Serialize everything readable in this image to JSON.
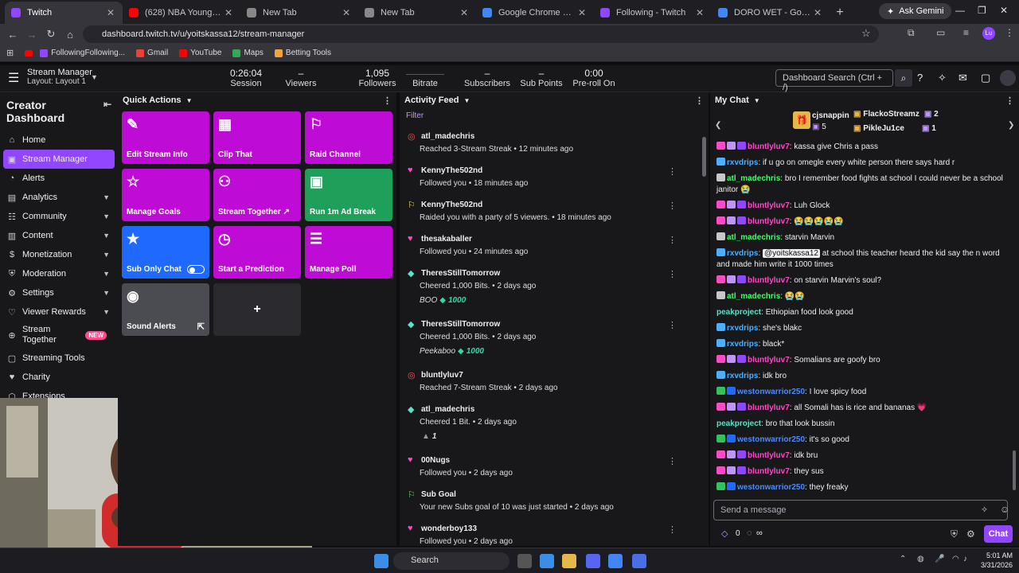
{
  "browser": {
    "tabs": [
      {
        "title": "Twitch",
        "color": "#9147ff"
      },
      {
        "title": "(628) NBA Youngboy - Boss",
        "color": "#ff0000"
      },
      {
        "title": "New Tab",
        "color": "#888888"
      },
      {
        "title": "New Tab",
        "color": "#888888"
      },
      {
        "title": "Google Chrome Help",
        "color": "#4285f4"
      },
      {
        "title": "Following - Twitch",
        "color": "#9147ff"
      },
      {
        "title": "DORO WET - Google Search",
        "color": "#4285f4"
      }
    ],
    "ask_gemini": "Ask Gemini",
    "url": "dashboard.twitch.tv/u/yoitskassa12/stream-manager",
    "profile_initials": "Lu",
    "bookmarks": [
      "FollowingFollowing...",
      "Gmail",
      "YouTube",
      "Maps",
      "Betting Tools"
    ]
  },
  "header": {
    "title": "Stream Manager",
    "subtitle": "Layout: Layout 1",
    "stats": [
      {
        "value": "0:26:04",
        "label": "Session"
      },
      {
        "value": "–",
        "label": "Viewers"
      },
      {
        "value": "1,095",
        "label": "Followers"
      },
      {
        "value": "",
        "label": "Bitrate"
      },
      {
        "value": "–",
        "label": "Subscribers"
      },
      {
        "value": "–",
        "label": "Sub Points"
      },
      {
        "value": "0:00",
        "label": "Pre-roll On"
      }
    ],
    "search_placeholder": "Dashboard Search (Ctrl + /)"
  },
  "sidebar": {
    "title": "Creator Dashboard",
    "items": [
      {
        "label": "Home"
      },
      {
        "label": "Stream Manager"
      },
      {
        "label": "Alerts"
      },
      {
        "label": "Analytics"
      },
      {
        "label": "Community"
      },
      {
        "label": "Content"
      },
      {
        "label": "Monetization"
      },
      {
        "label": "Moderation"
      },
      {
        "label": "Settings"
      },
      {
        "label": "Viewer Rewards"
      },
      {
        "label": "Stream Together",
        "badge": "NEW"
      },
      {
        "label": "Streaming Tools"
      },
      {
        "label": "Charity"
      },
      {
        "label": "Extensions"
      }
    ]
  },
  "quick_actions": {
    "title": "Quick Actions",
    "tiles": [
      {
        "label": "Edit Stream Info",
        "color": "#bf0bd6",
        "icon": "pencil-icon"
      },
      {
        "label": "Clip That",
        "color": "#bf0bd6",
        "icon": "clapper-icon"
      },
      {
        "label": "Raid Channel",
        "color": "#bf0bd6",
        "icon": "raid-icon"
      },
      {
        "label": "Manage Goals",
        "color": "#bf0bd6",
        "icon": "star-icon"
      },
      {
        "label": "Stream Together ↗",
        "color": "#bf0bd6",
        "icon": "add-user-icon"
      },
      {
        "label": "Run 1m Ad Break",
        "color": "#1fa05a",
        "icon": "ad-icon"
      },
      {
        "label": "Sub Only Chat",
        "color": "#1f69ff",
        "icon": "star-icon"
      },
      {
        "label": "Start a Prediction",
        "color": "#bf0bd6",
        "icon": "prediction-icon"
      },
      {
        "label": "Manage Poll",
        "color": "#bf0bd6",
        "icon": "poll-icon"
      },
      {
        "label": "Sound Alerts",
        "color": "#4b4b52",
        "icon": "sound-icon"
      },
      {
        "label": "+",
        "color": "#2a2a2f",
        "icon": "plus-icon"
      }
    ]
  },
  "activity": {
    "title": "Activity Feed",
    "filter": "Filter",
    "events": [
      {
        "name": "atl_madechris",
        "desc": "Reached 3-Stream Streak • 12 minutes ago",
        "icon": "streak-icon",
        "color": "#ff4a4a"
      },
      {
        "name": "KennyThe502nd",
        "desc": "Followed you • 18 minutes ago",
        "icon": "heart-icon",
        "color": "#ff4ac8"
      },
      {
        "name": "KennyThe502nd",
        "desc": "Raided you with a party of 5 viewers. • 18 minutes ago",
        "icon": "raid-icon",
        "color": "#f4e04d"
      },
      {
        "name": "thesakaballer",
        "desc": "Followed you • 24 minutes ago",
        "icon": "heart-icon",
        "color": "#ff4ac8"
      },
      {
        "name": "TheresStillTomorrow",
        "desc": "Cheered 1,000 Bits. • 2 days ago",
        "icon": "bits-icon",
        "color": "#5ce1c6",
        "extra": "BOO",
        "bits": "1000"
      },
      {
        "name": "TheresStillTomorrow",
        "desc": "Cheered 1,000 Bits. • 2 days ago",
        "icon": "bits-icon",
        "color": "#5ce1c6",
        "extra": "Peekaboo",
        "bits": "1000"
      },
      {
        "name": "bluntlyluv7",
        "desc": "Reached 7-Stream Streak • 2 days ago",
        "icon": "streak-icon",
        "color": "#ff4a4a"
      },
      {
        "name": "atl_madechris",
        "desc": "Cheered 1 Bit. • 2 days ago",
        "icon": "bits-icon",
        "color": "#5ce1c6",
        "bits": "1"
      },
      {
        "name": "00Nugs",
        "desc": "Followed you • 2 days ago",
        "icon": "heart-icon",
        "color": "#ff4ac8"
      },
      {
        "name": "Sub Goal",
        "desc": "Your new Subs goal of 10 was just started • 2 days ago",
        "icon": "goal-icon",
        "color": "#5ce15c"
      },
      {
        "name": "wonderboy133",
        "desc": "Followed you • 2 days ago",
        "icon": "heart-icon",
        "color": "#ff4ac8"
      }
    ]
  },
  "chat": {
    "title": "My Chat",
    "leaderboard": [
      {
        "name": "cjsnappin",
        "count": "5"
      },
      {
        "name": "FlackoStreamz",
        "count": "2"
      },
      {
        "name": "PikleJu1ce",
        "count": "1"
      }
    ],
    "messages": [
      {
        "user": "bluntlyluv7",
        "color": "#ff4ac8",
        "text": ": kassa give Chris a pass"
      },
      {
        "user": "rxvdrips",
        "color": "#4ab0ff",
        "text": ": if u go on omegle every white person there says hard r"
      },
      {
        "user": "atl_madechris",
        "color": "#3cff64",
        "text": ": bro I remember food fights at school I could never be a school janitor 😭"
      },
      {
        "user": "bluntlyluv7",
        "color": "#ff4ac8",
        "text": ": Luh Glock"
      },
      {
        "user": "bluntlyluv7",
        "color": "#ff4ac8",
        "text": ": 😭😭😭😭😭"
      },
      {
        "user": "atl_madechris",
        "color": "#3cff64",
        "text": ": starvin Marvin"
      },
      {
        "user": "rxvdrips",
        "color": "#4ab0ff",
        "mention": "@yoitskassa12",
        "text": " at school this teacher heard the kid say the n word and made him write it 1000 times"
      },
      {
        "user": "bluntlyluv7",
        "color": "#ff4ac8",
        "text": ": on starvin Marvin's soul?"
      },
      {
        "user": "atl_madechris",
        "color": "#3cff64",
        "text": ": 😭😭"
      },
      {
        "user": "peakproject",
        "color": "#5ce1c6",
        "text": ": Ethiopian food look good"
      },
      {
        "user": "rxvdrips",
        "color": "#4ab0ff",
        "text": ": she's blakc"
      },
      {
        "user": "rxvdrips",
        "color": "#4ab0ff",
        "text": ": black*"
      },
      {
        "user": "bluntlyluv7",
        "color": "#ff4ac8",
        "text": ": Somalians are goofy bro"
      },
      {
        "user": "rxvdrips",
        "color": "#4ab0ff",
        "text": ": idk bro"
      },
      {
        "user": "westonwarrior250",
        "color": "#4a8cff",
        "text": ": I love spicy food"
      },
      {
        "user": "bluntlyluv7",
        "color": "#ff4ac8",
        "text": ": all Somali has is rice and bananas 💗"
      },
      {
        "user": "peakproject",
        "color": "#5ce1c6",
        "text": ": bro that look bussin"
      },
      {
        "user": "westonwarrior250",
        "color": "#4a8cff",
        "text": ": it's so good"
      },
      {
        "user": "bluntlyluv7",
        "color": "#ff4ac8",
        "text": ": idk bru"
      },
      {
        "user": "bluntlyluv7",
        "color": "#ff4ac8",
        "text": ": they sus"
      },
      {
        "user": "westonwarrior250",
        "color": "#4a8cff",
        "text": ": they freaky"
      }
    ],
    "input_placeholder": "Send a message",
    "points": "0",
    "infinity": "∞",
    "send_label": "Chat"
  },
  "taskbar": {
    "search": "Search",
    "time": "5:01 AM",
    "date": "3/31/2026"
  }
}
